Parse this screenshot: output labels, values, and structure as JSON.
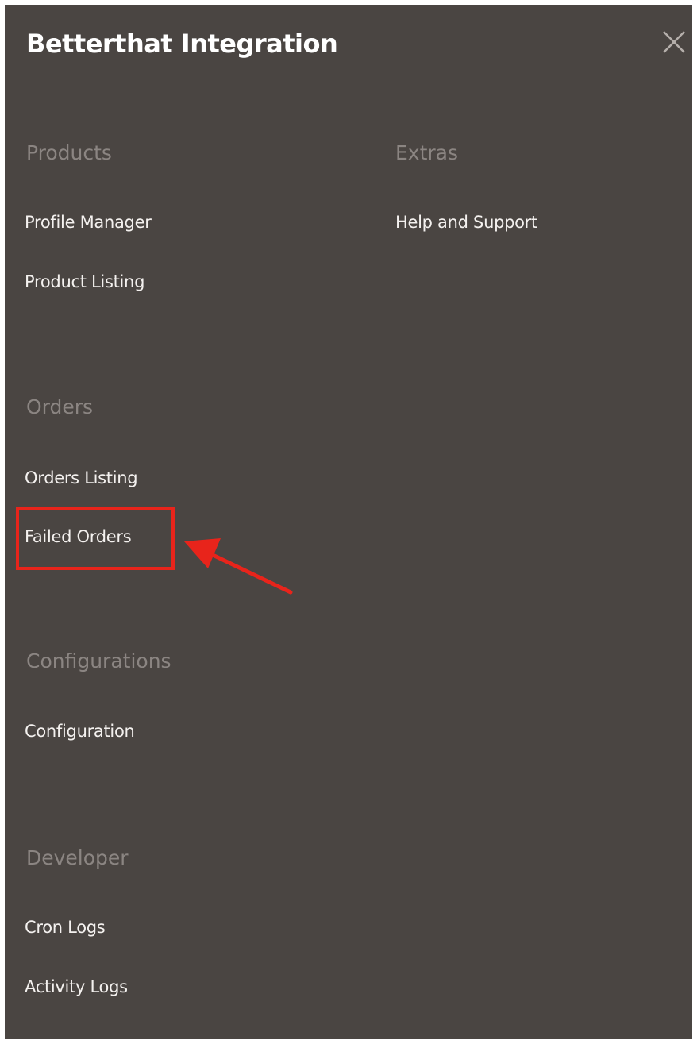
{
  "panel": {
    "title": "Betterthat Integration"
  },
  "sections": {
    "products": {
      "heading": "Products",
      "items": [
        "Profile Manager",
        "Product Listing"
      ]
    },
    "extras": {
      "heading": "Extras",
      "items": [
        "Help and Support"
      ]
    },
    "orders": {
      "heading": "Orders",
      "items": [
        "Orders Listing",
        "Failed Orders"
      ]
    },
    "configurations": {
      "heading": "Configurations",
      "items": [
        "Configuration"
      ]
    },
    "developer": {
      "heading": "Developer",
      "items": [
        "Cron Logs",
        "Activity Logs"
      ]
    }
  },
  "icons": {
    "close": "close-icon"
  },
  "colors": {
    "panel_background": "#4a4542",
    "heading_text": "#8b8582",
    "item_text": "#f4f1ef",
    "annotation": "#e8241b"
  }
}
